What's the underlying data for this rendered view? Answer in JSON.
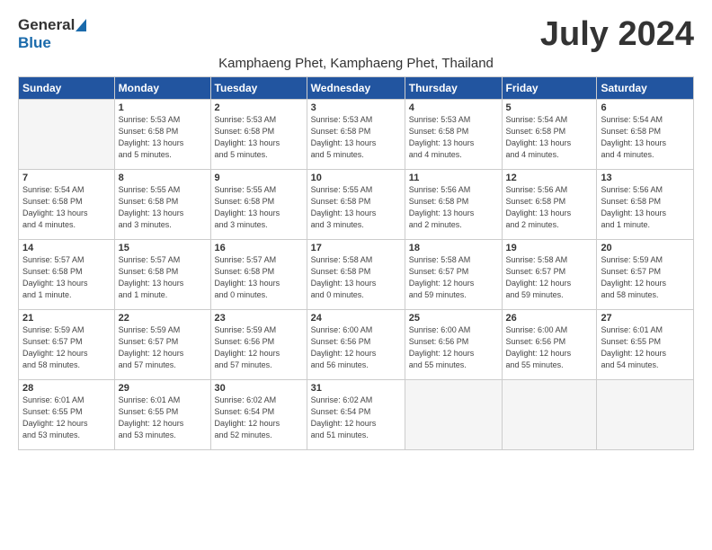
{
  "logo": {
    "general": "General",
    "blue": "Blue"
  },
  "title": "July 2024",
  "subtitle": "Kamphaeng Phet, Kamphaeng Phet, Thailand",
  "days_of_week": [
    "Sunday",
    "Monday",
    "Tuesday",
    "Wednesday",
    "Thursday",
    "Friday",
    "Saturday"
  ],
  "weeks": [
    [
      {
        "num": "",
        "info": ""
      },
      {
        "num": "1",
        "info": "Sunrise: 5:53 AM\nSunset: 6:58 PM\nDaylight: 13 hours\nand 5 minutes."
      },
      {
        "num": "2",
        "info": "Sunrise: 5:53 AM\nSunset: 6:58 PM\nDaylight: 13 hours\nand 5 minutes."
      },
      {
        "num": "3",
        "info": "Sunrise: 5:53 AM\nSunset: 6:58 PM\nDaylight: 13 hours\nand 5 minutes."
      },
      {
        "num": "4",
        "info": "Sunrise: 5:53 AM\nSunset: 6:58 PM\nDaylight: 13 hours\nand 4 minutes."
      },
      {
        "num": "5",
        "info": "Sunrise: 5:54 AM\nSunset: 6:58 PM\nDaylight: 13 hours\nand 4 minutes."
      },
      {
        "num": "6",
        "info": "Sunrise: 5:54 AM\nSunset: 6:58 PM\nDaylight: 13 hours\nand 4 minutes."
      }
    ],
    [
      {
        "num": "7",
        "info": "Sunrise: 5:54 AM\nSunset: 6:58 PM\nDaylight: 13 hours\nand 4 minutes."
      },
      {
        "num": "8",
        "info": "Sunrise: 5:55 AM\nSunset: 6:58 PM\nDaylight: 13 hours\nand 3 minutes."
      },
      {
        "num": "9",
        "info": "Sunrise: 5:55 AM\nSunset: 6:58 PM\nDaylight: 13 hours\nand 3 minutes."
      },
      {
        "num": "10",
        "info": "Sunrise: 5:55 AM\nSunset: 6:58 PM\nDaylight: 13 hours\nand 3 minutes."
      },
      {
        "num": "11",
        "info": "Sunrise: 5:56 AM\nSunset: 6:58 PM\nDaylight: 13 hours\nand 2 minutes."
      },
      {
        "num": "12",
        "info": "Sunrise: 5:56 AM\nSunset: 6:58 PM\nDaylight: 13 hours\nand 2 minutes."
      },
      {
        "num": "13",
        "info": "Sunrise: 5:56 AM\nSunset: 6:58 PM\nDaylight: 13 hours\nand 1 minute."
      }
    ],
    [
      {
        "num": "14",
        "info": "Sunrise: 5:57 AM\nSunset: 6:58 PM\nDaylight: 13 hours\nand 1 minute."
      },
      {
        "num": "15",
        "info": "Sunrise: 5:57 AM\nSunset: 6:58 PM\nDaylight: 13 hours\nand 1 minute."
      },
      {
        "num": "16",
        "info": "Sunrise: 5:57 AM\nSunset: 6:58 PM\nDaylight: 13 hours\nand 0 minutes."
      },
      {
        "num": "17",
        "info": "Sunrise: 5:58 AM\nSunset: 6:58 PM\nDaylight: 13 hours\nand 0 minutes."
      },
      {
        "num": "18",
        "info": "Sunrise: 5:58 AM\nSunset: 6:57 PM\nDaylight: 12 hours\nand 59 minutes."
      },
      {
        "num": "19",
        "info": "Sunrise: 5:58 AM\nSunset: 6:57 PM\nDaylight: 12 hours\nand 59 minutes."
      },
      {
        "num": "20",
        "info": "Sunrise: 5:59 AM\nSunset: 6:57 PM\nDaylight: 12 hours\nand 58 minutes."
      }
    ],
    [
      {
        "num": "21",
        "info": "Sunrise: 5:59 AM\nSunset: 6:57 PM\nDaylight: 12 hours\nand 58 minutes."
      },
      {
        "num": "22",
        "info": "Sunrise: 5:59 AM\nSunset: 6:57 PM\nDaylight: 12 hours\nand 57 minutes."
      },
      {
        "num": "23",
        "info": "Sunrise: 5:59 AM\nSunset: 6:56 PM\nDaylight: 12 hours\nand 57 minutes."
      },
      {
        "num": "24",
        "info": "Sunrise: 6:00 AM\nSunset: 6:56 PM\nDaylight: 12 hours\nand 56 minutes."
      },
      {
        "num": "25",
        "info": "Sunrise: 6:00 AM\nSunset: 6:56 PM\nDaylight: 12 hours\nand 55 minutes."
      },
      {
        "num": "26",
        "info": "Sunrise: 6:00 AM\nSunset: 6:56 PM\nDaylight: 12 hours\nand 55 minutes."
      },
      {
        "num": "27",
        "info": "Sunrise: 6:01 AM\nSunset: 6:55 PM\nDaylight: 12 hours\nand 54 minutes."
      }
    ],
    [
      {
        "num": "28",
        "info": "Sunrise: 6:01 AM\nSunset: 6:55 PM\nDaylight: 12 hours\nand 53 minutes."
      },
      {
        "num": "29",
        "info": "Sunrise: 6:01 AM\nSunset: 6:55 PM\nDaylight: 12 hours\nand 53 minutes."
      },
      {
        "num": "30",
        "info": "Sunrise: 6:02 AM\nSunset: 6:54 PM\nDaylight: 12 hours\nand 52 minutes."
      },
      {
        "num": "31",
        "info": "Sunrise: 6:02 AM\nSunset: 6:54 PM\nDaylight: 12 hours\nand 51 minutes."
      },
      {
        "num": "",
        "info": ""
      },
      {
        "num": "",
        "info": ""
      },
      {
        "num": "",
        "info": ""
      }
    ]
  ]
}
